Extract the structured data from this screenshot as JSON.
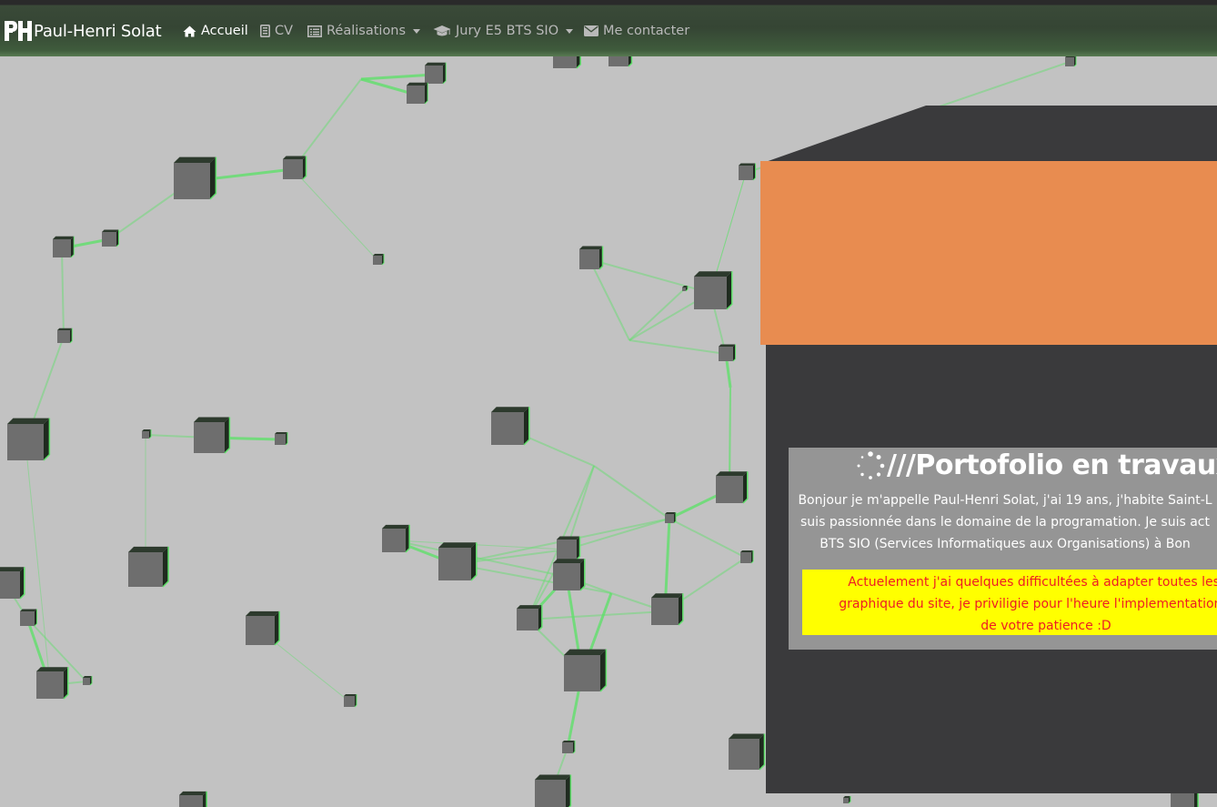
{
  "navbar": {
    "brand": "Paul-Henri Solat",
    "items": [
      {
        "label": "Accueil",
        "icon": "home-icon",
        "active": true
      },
      {
        "label": "CV",
        "icon": "file-icon"
      },
      {
        "label": "Réalisations",
        "icon": "list-icon",
        "dropdown": true
      },
      {
        "label": "Jury E5 BTS SIO",
        "icon": "graduation-cap-icon",
        "dropdown": true
      },
      {
        "label": "Me contacter",
        "icon": "envelope-icon"
      }
    ]
  },
  "card": {
    "title": "///Portofolio en travaux...",
    "intro_lines": [
      "Bonjour je m'appelle Paul-Henri Solat, j'ai 19 ans, j'habite Saint-L",
      "suis passionnée dans le domaine de la programation. Je suis act",
      "BTS SIO (Services Informatiques aux Organisations) à Bon"
    ],
    "warning_lines": [
      "Actuelement j'ai quelques difficultées à adapter toutes les fon",
      "graphique du site, je priviligie pour l'heure l'implementation du c",
      "de votre patience :D"
    ]
  },
  "colors": {
    "background": "#c2c2c2",
    "line": "#5fe06a",
    "cube": "#6e6e6e",
    "panel": "#3a3a3c",
    "orange": "#e88c50",
    "card": "#959595",
    "warning_bg": "#ffff00",
    "warning_text": "#ee1c24"
  }
}
